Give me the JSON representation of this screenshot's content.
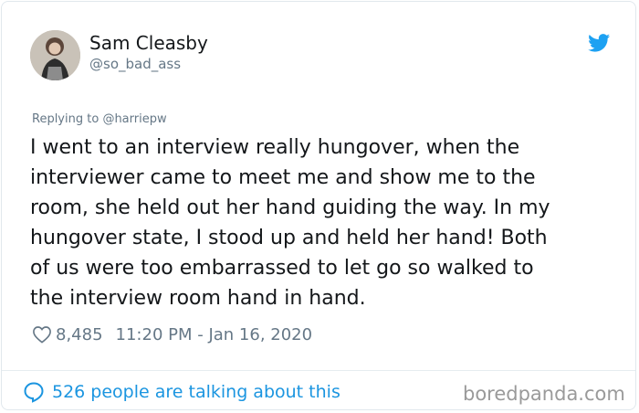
{
  "author": {
    "name": "Sam Cleasby",
    "handle": "@so_bad_ass"
  },
  "reply": {
    "prefix": "Replying to",
    "mention": "@harriepw"
  },
  "tweet": {
    "lines": [
      "I went to an interview really hungover, when the",
      "interviewer came to meet me and show me to the",
      "room, she held out her hand guiding the way. In my",
      "hungover state, I stood up and held her hand! Both",
      "of us were too embarrassed to let go so walked to",
      "the interview room hand in hand."
    ]
  },
  "stats": {
    "likes": "8,485",
    "timestamp": "11:20 PM - Jan 16, 2020"
  },
  "footer": {
    "talking": "526 people are talking about this",
    "watermark": "boredpanda.com"
  },
  "colors": {
    "twitter_blue": "#1da1f2",
    "link_blue": "#1b95e0",
    "secondary_text": "#657786"
  },
  "icons": {
    "brand": "twitter-bird-icon",
    "like": "heart-outline-icon",
    "conversation": "speech-bubble-icon"
  }
}
